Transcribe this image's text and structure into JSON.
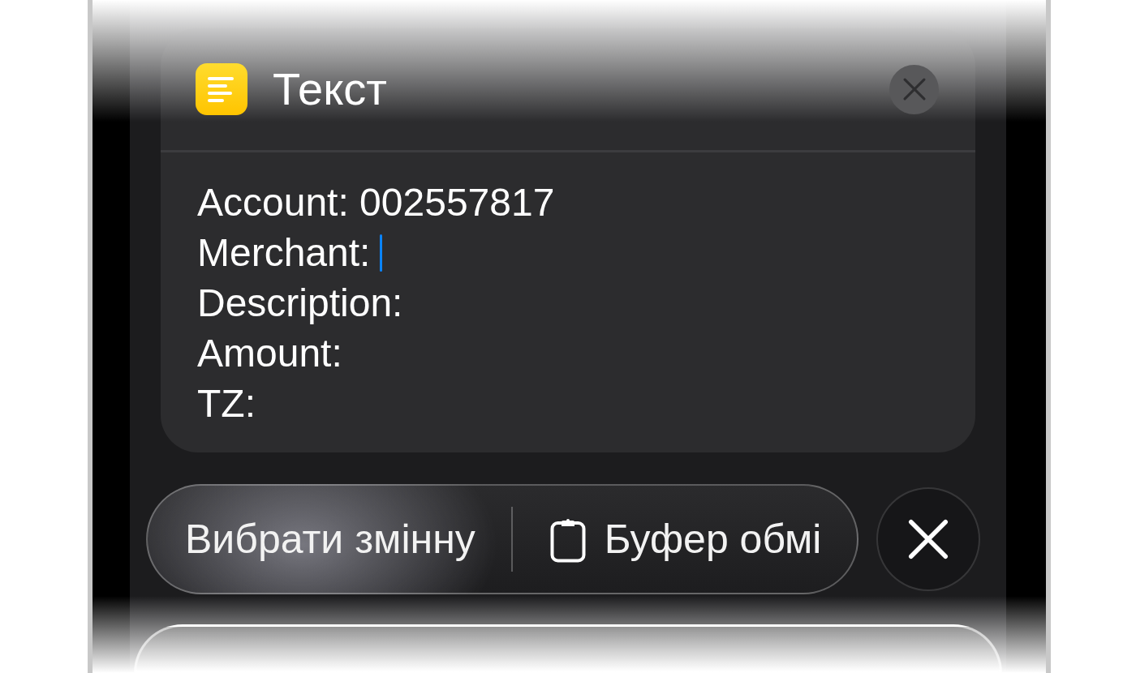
{
  "editor": {
    "title": "Текст",
    "lines": [
      {
        "text": "Account: 002557817",
        "cursor": false
      },
      {
        "text": "Merchant:",
        "cursor": true
      },
      {
        "text": "Description:",
        "cursor": false
      },
      {
        "text": "Amount:",
        "cursor": false
      },
      {
        "text": "TZ:",
        "cursor": false
      }
    ]
  },
  "toolbar": {
    "buttons": [
      {
        "kind": "plain",
        "label": "Вибрати змінну"
      },
      {
        "kind": "with-icon",
        "label": "Буфер обмі"
      }
    ]
  }
}
